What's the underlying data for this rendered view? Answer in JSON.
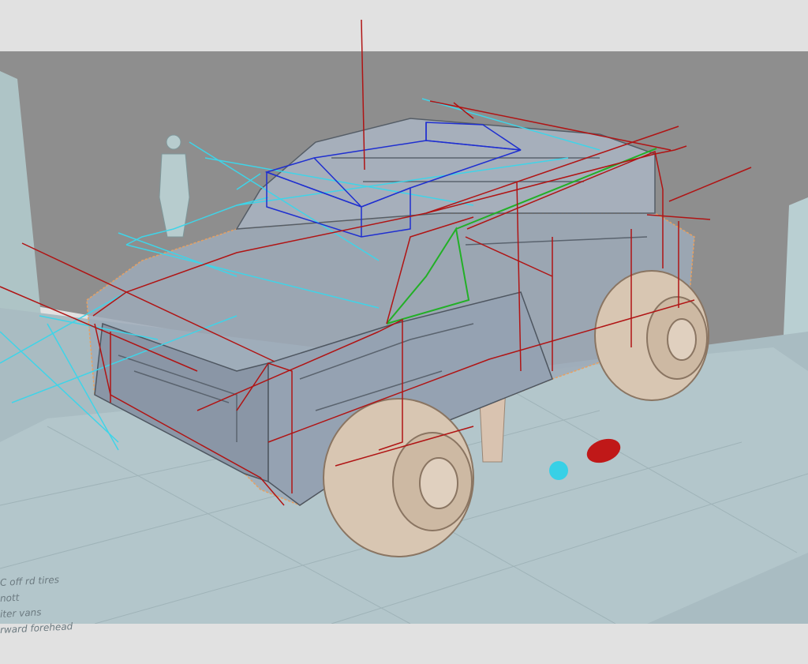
{
  "scene": {
    "colors": {
      "background": "#e1e1e1",
      "back_wall": "#8e8e8e",
      "floor": "#a9bcc2",
      "vehicle_body": "#9eaab8",
      "tires": "#d8c6b2",
      "construction_red": "#b01414",
      "construction_cyan": "#3fd4e8",
      "construction_blue": "#1f2fd0",
      "construction_green": "#22b026",
      "marker_red": "#c01818",
      "marker_cyan": "#38d0e6"
    }
  },
  "notes": {
    "line1": "C off rd tires",
    "line2": "nott",
    "line3": "iter vans",
    "line4": "rward forehead"
  }
}
